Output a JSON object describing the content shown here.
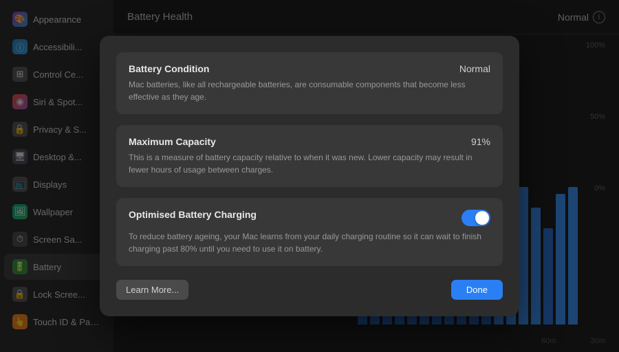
{
  "sidebar": {
    "items": [
      {
        "id": "appearance",
        "label": "Appearance",
        "icon": "appearance",
        "active": false
      },
      {
        "id": "accessibility",
        "label": "Accessibili...",
        "icon": "accessibility",
        "active": false
      },
      {
        "id": "control",
        "label": "Control Ce...",
        "icon": "control",
        "active": false
      },
      {
        "id": "siri",
        "label": "Siri & Spot...",
        "icon": "siri",
        "active": false
      },
      {
        "id": "privacy",
        "label": "Privacy & S...",
        "icon": "privacy",
        "active": false
      },
      {
        "id": "desktop",
        "label": "Desktop &...",
        "icon": "desktop",
        "active": false
      },
      {
        "id": "displays",
        "label": "Displays",
        "icon": "displays",
        "active": false
      },
      {
        "id": "wallpaper",
        "label": "Wallpaper",
        "icon": "wallpaper",
        "active": false
      },
      {
        "id": "screensaver",
        "label": "Screen Sa...",
        "icon": "screensaver",
        "active": false
      },
      {
        "id": "battery",
        "label": "Battery",
        "icon": "battery",
        "active": true
      },
      {
        "id": "lockscreen",
        "label": "Lock Scree...",
        "icon": "lockscreen",
        "active": false
      },
      {
        "id": "touchid",
        "label": "Touch ID & Password",
        "icon": "touchid",
        "active": false
      }
    ]
  },
  "topbar": {
    "title": "Battery Health",
    "status": "Normal"
  },
  "modal": {
    "battery_condition": {
      "title": "Battery Condition",
      "value": "Normal",
      "description": "Mac batteries, like all rechargeable batteries, are consumable components that become less effective as they age."
    },
    "maximum_capacity": {
      "title": "Maximum Capacity",
      "value": "91%",
      "description": "This is a measure of battery capacity relative to when it was new. Lower capacity may result in fewer hours of usage between charges."
    },
    "optimised_charging": {
      "title": "Optimised Battery Charging",
      "description": "To reduce battery ageing, your Mac learns from your daily charging routine so it can wait to finish charging past 80% until you need to use it on battery.",
      "enabled": true
    },
    "learn_more_label": "Learn More...",
    "done_label": "Done"
  },
  "chart": {
    "labels_right": [
      "100%",
      "50%",
      "0%"
    ],
    "time_labels": [
      "60m",
      "30m"
    ],
    "bars": [
      20,
      30,
      25,
      15,
      35,
      40,
      20,
      25,
      30,
      15,
      10,
      80,
      90,
      100,
      85,
      70,
      95,
      100
    ]
  }
}
